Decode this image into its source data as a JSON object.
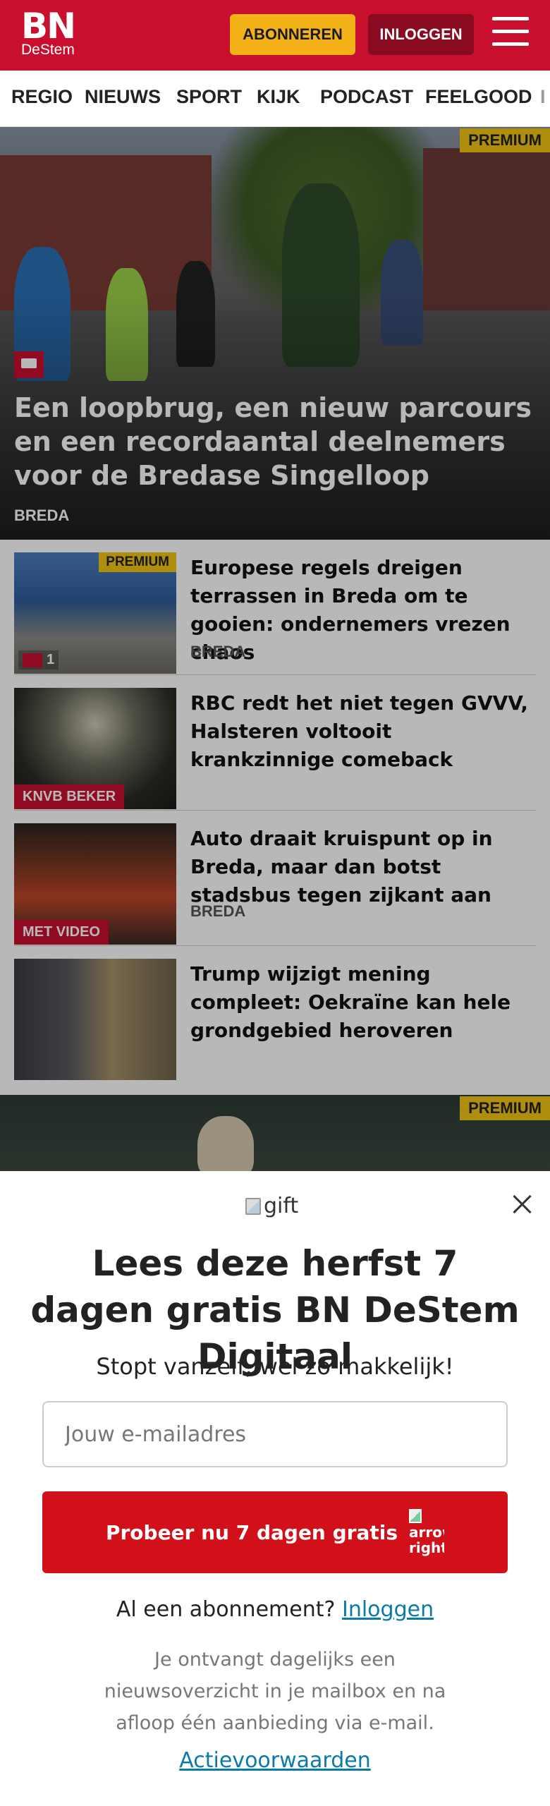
{
  "header": {
    "logo_top": "BN",
    "logo_bottom": "DeStem",
    "subscribe_label": "ABONNEREN",
    "login_label": "INLOGGEN",
    "brand_color": "#c8102e"
  },
  "nav": {
    "items": [
      "REGIO",
      "NIEUWS",
      "SPORT",
      "KIJK",
      "PODCAST",
      "FEELGOOD",
      "I"
    ]
  },
  "hero": {
    "badge": "PREMIUM",
    "title": "Een loopbrug, een nieuw parcours en een recordaantal deelnemers voor de Bredase Singelloop",
    "region": "BREDA",
    "icon": "comment-icon"
  },
  "articles": [
    {
      "title": "Europese regels dreigen terrassen in Breda om te gooien: ondernemers vrezen chaos",
      "region": "BREDA",
      "badge": "PREMIUM",
      "comments": "1"
    },
    {
      "title": "RBC redt het niet tegen GVVV, Halsteren voltooit krankzinnige comeback",
      "region": "",
      "tag": "KNVB BEKER"
    },
    {
      "title": "Auto draait kruispunt op in Breda, maar dan botst stadsbus tegen zijkant aan",
      "region": "BREDA",
      "tag": "MET VIDEO"
    },
    {
      "title": "Trump wijzigt mening compleet: Oekraïne kan hele grondgebied heroveren",
      "region": ""
    }
  ],
  "next_hero": {
    "badge": "PREMIUM"
  },
  "modal": {
    "gift_alt": "gift",
    "title": "Lees deze herfst 7 dagen gratis BN DeStem Digitaal",
    "subtitle": "Stopt vanzelf, wel zo makkelijk!",
    "email_placeholder": "Jouw e-mailadres",
    "cta_label": "Probeer nu 7 dagen gratis",
    "cta_arrow_alt": "arrow-right",
    "have_sub_text": "Al een abonnement?",
    "have_sub_link": "Inloggen",
    "info": "Je ontvangt dagelijks een nieuwsoverzicht in je mailbox en na afloop één aanbieding via e-mail.",
    "terms_link": "Actievoorwaarden",
    "cta_color": "#d1101a",
    "link_color": "#0a7ba8"
  }
}
